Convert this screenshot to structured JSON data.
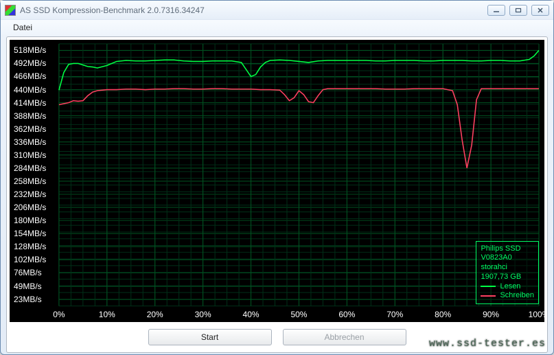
{
  "window": {
    "title": "AS SSD Kompression-Benchmark 2.0.7316.34247"
  },
  "menu": {
    "file": "Datei"
  },
  "buttons": {
    "start": "Start",
    "cancel": "Abbrechen"
  },
  "legend": {
    "device": "Philips SSD",
    "firmware": "V0823A0",
    "driver": "storahci",
    "capacity": "1907,73 GB",
    "read": "Lesen",
    "write": "Schreiben",
    "read_color": "#00ff44",
    "write_color": "#ff4060"
  },
  "watermark": "www.ssd-tester.es",
  "chart_data": {
    "type": "line",
    "xlabel": "",
    "ylabel": "",
    "y_unit": "MB/s",
    "y_ticks": [
      23,
      49,
      76,
      102,
      128,
      154,
      180,
      206,
      232,
      258,
      284,
      310,
      336,
      362,
      388,
      414,
      440,
      466,
      492,
      518
    ],
    "x_ticks": [
      0,
      10,
      20,
      30,
      40,
      50,
      60,
      70,
      80,
      90,
      100
    ],
    "x_tick_labels": [
      "0%",
      "10%",
      "20%",
      "30%",
      "40%",
      "50%",
      "60%",
      "70%",
      "80%",
      "90%",
      "100%"
    ],
    "xlim": [
      0,
      100
    ],
    "ylim": [
      10,
      531
    ],
    "series": [
      {
        "name": "Lesen",
        "color": "#00ff44",
        "x": [
          0,
          1,
          2,
          3,
          4,
          5,
          6,
          7,
          8,
          10,
          12,
          14,
          16,
          18,
          20,
          22,
          24,
          26,
          28,
          30,
          32,
          34,
          36,
          38,
          39,
          40,
          41,
          42,
          43,
          44,
          46,
          48,
          50,
          52,
          54,
          56,
          58,
          60,
          62,
          64,
          66,
          68,
          70,
          72,
          74,
          76,
          78,
          80,
          82,
          84,
          86,
          88,
          90,
          92,
          94,
          96,
          98,
          99,
          100
        ],
        "y": [
          439,
          474,
          490,
          492,
          492,
          489,
          486,
          485,
          483,
          488,
          496,
          498,
          497,
          497,
          498,
          499,
          499,
          497,
          496,
          496,
          497,
          497,
          497,
          494,
          480,
          466,
          470,
          485,
          494,
          498,
          499,
          498,
          496,
          494,
          497,
          498,
          498,
          498,
          498,
          498,
          497,
          497,
          498,
          498,
          498,
          497,
          497,
          498,
          498,
          498,
          497,
          497,
          498,
          498,
          497,
          497,
          500,
          507,
          518
        ]
      },
      {
        "name": "Schreiben",
        "color": "#ff4060",
        "x": [
          0,
          1,
          2,
          3,
          4,
          5,
          6,
          7,
          8,
          10,
          12,
          14,
          16,
          18,
          20,
          22,
          24,
          26,
          28,
          30,
          32,
          34,
          36,
          38,
          40,
          42,
          44,
          46,
          47,
          48,
          49,
          50,
          51,
          52,
          53,
          54,
          55,
          56,
          58,
          60,
          62,
          64,
          66,
          68,
          70,
          72,
          74,
          76,
          78,
          80,
          82,
          83,
          84,
          85,
          86,
          87,
          88,
          90,
          92,
          94,
          96,
          98,
          100
        ],
        "y": [
          410,
          412,
          414,
          418,
          417,
          418,
          428,
          435,
          438,
          440,
          440,
          441,
          441,
          440,
          441,
          441,
          442,
          442,
          441,
          441,
          442,
          442,
          441,
          441,
          441,
          440,
          440,
          439,
          430,
          418,
          424,
          438,
          430,
          416,
          414,
          428,
          440,
          442,
          442,
          442,
          442,
          442,
          442,
          441,
          441,
          441,
          442,
          442,
          442,
          442,
          438,
          410,
          340,
          284,
          330,
          420,
          442,
          442,
          442,
          442,
          442,
          442,
          442
        ]
      }
    ]
  }
}
